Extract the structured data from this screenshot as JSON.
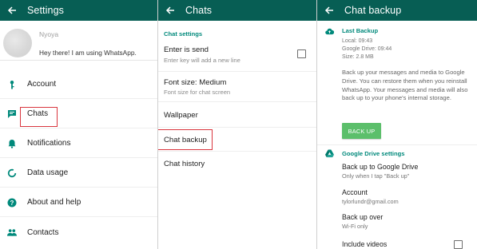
{
  "colors": {
    "appbar": "#075e54",
    "accent": "#00897b",
    "button": "#5cbf6b",
    "highlight": "#d9363e"
  },
  "settings": {
    "title": "Settings",
    "profile": {
      "name": "Nyoya",
      "status": "Hey there! I am using WhatsApp."
    },
    "items": [
      {
        "label": "Account",
        "icon": "key-icon"
      },
      {
        "label": "Chats",
        "icon": "chat-icon"
      },
      {
        "label": "Notifications",
        "icon": "bell-icon"
      },
      {
        "label": "Data usage",
        "icon": "data-usage-icon"
      },
      {
        "label": "About and help",
        "icon": "help-icon"
      },
      {
        "label": "Contacts",
        "icon": "contacts-icon"
      }
    ]
  },
  "chats": {
    "title": "Chats",
    "section": "Chat settings",
    "enter_is_send": {
      "title": "Enter is send",
      "subtitle": "Enter key will add a new line",
      "checked": false
    },
    "font_size": {
      "title": "Font size: Medium",
      "subtitle": "Font size for chat screen"
    },
    "wallpaper": "Wallpaper",
    "chat_backup": "Chat backup",
    "chat_history": "Chat history"
  },
  "backup": {
    "title": "Chat backup",
    "last_backup": {
      "header": "Last Backup",
      "local": "Local: 09:43",
      "google_drive": "Google Drive: 09:44",
      "size": "Size: 2.8 MB",
      "description": "Back up your messages and media to Google Drive. You can restore them when you reinstall WhatsApp. Your messages and media will also back up to your phone's internal storage.",
      "button": "BACK UP"
    },
    "drive_settings": {
      "header": "Google Drive settings",
      "backup_to_drive": {
        "title": "Back up to Google Drive",
        "value": "Only when I tap \"Back up\""
      },
      "account": {
        "title": "Account",
        "value": "tylorlundr@gmail.com"
      },
      "backup_over": {
        "title": "Back up over",
        "value": "Wi-Fi only"
      },
      "include_videos": {
        "title": "Include videos",
        "checked": false
      }
    }
  }
}
